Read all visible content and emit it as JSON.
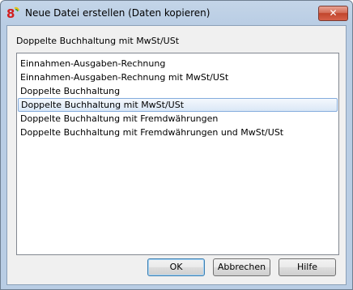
{
  "window": {
    "title": "Neue Datei erstellen (Daten kopieren)",
    "close_label": "✕",
    "app_icon": "banana-app-icon"
  },
  "main": {
    "section_label": "Doppelte Buchhaltung mit MwSt/USt",
    "list": {
      "selected_index": 3,
      "items": [
        "Einnahmen-Ausgaben-Rechnung",
        "Einnahmen-Ausgaben-Rechnung mit MwSt/USt",
        "Doppelte Buchhaltung",
        "Doppelte Buchhaltung mit MwSt/USt",
        "Doppelte Buchhaltung mit Fremdwährungen",
        "Doppelte Buchhaltung mit Fremdwährungen und MwSt/USt"
      ]
    }
  },
  "buttons": {
    "ok_label": "OK",
    "cancel_label": "Abbrechen",
    "help_label": "Hilfe"
  },
  "colors": {
    "title_bar": "#b9cde4",
    "close_button": "#c1452c",
    "selection_border": "#84acdd",
    "dialog_background": "#f0f0f0"
  }
}
